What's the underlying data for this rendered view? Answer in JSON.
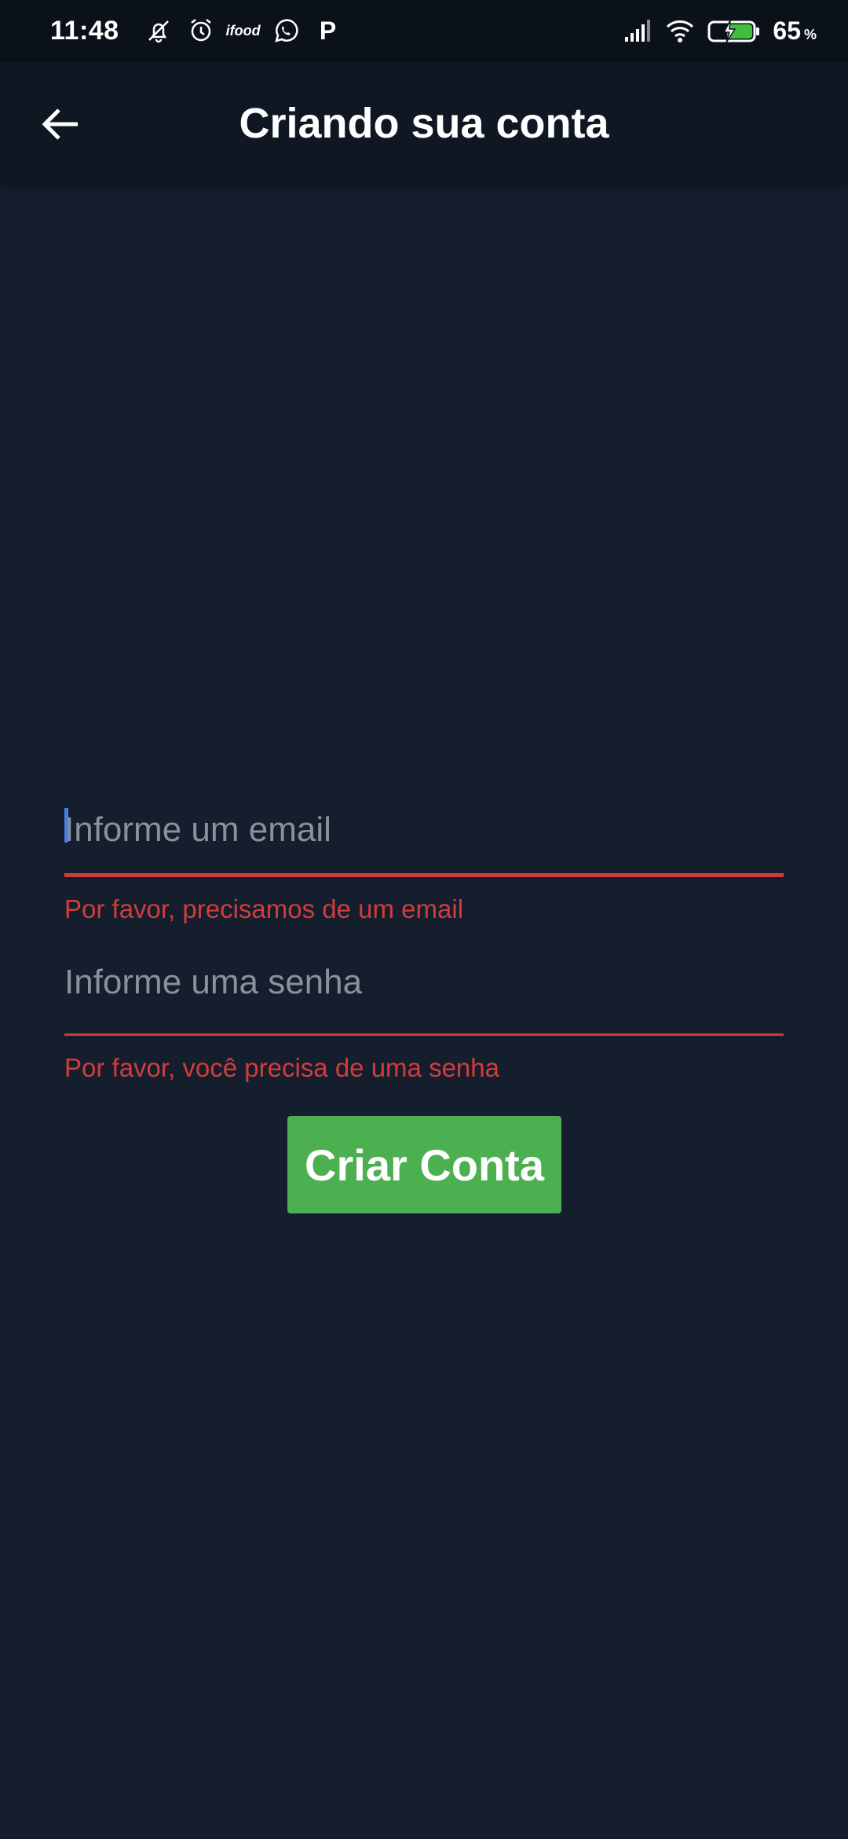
{
  "status_bar": {
    "time": "11:48",
    "left_icons": [
      "mute-icon",
      "alarm-icon",
      "ifood-icon",
      "whatsapp-icon",
      "p-app-icon"
    ],
    "ifood_label": "ifood",
    "p_label": "P",
    "battery_percent": "65",
    "battery_unit": "%"
  },
  "app_bar": {
    "title": "Criando sua conta"
  },
  "form": {
    "email_placeholder": "Informe um email",
    "email_value": "",
    "email_error": "Por favor, precisamos de um email",
    "password_placeholder": "Informe uma senha",
    "password_value": "",
    "password_error": "Por favor, você precisa de uma senha",
    "submit_label": "Criar Conta"
  },
  "colors": {
    "background": "#141e2d",
    "app_bar": "#0f1722",
    "error": "#d23c3c",
    "button": "#4caf50",
    "caret": "#4a7fe0"
  }
}
